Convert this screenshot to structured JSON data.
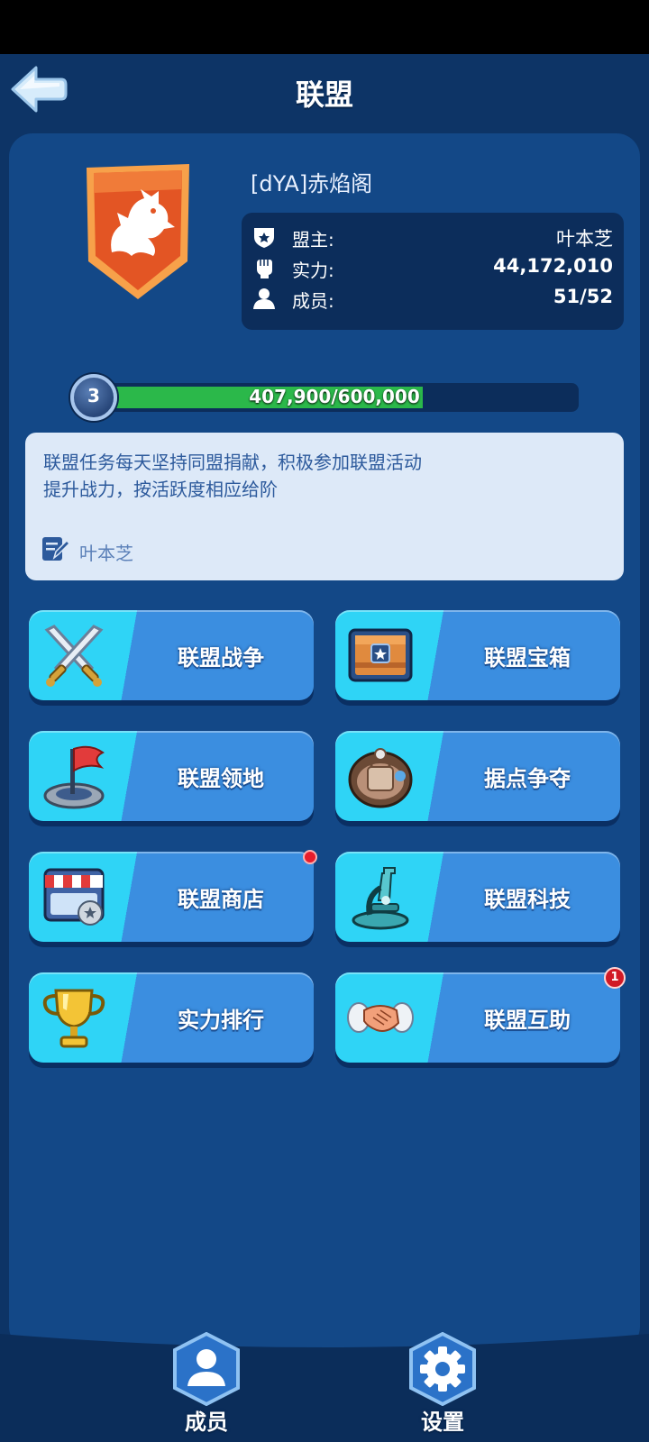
{
  "header": {
    "title": "联盟"
  },
  "alliance": {
    "name": "[dYA]赤焰阁",
    "leader_label": "盟主:",
    "leader": "叶本芝",
    "power_label": "实力:",
    "power": "44,172,010",
    "members_label": "成员:",
    "members": "51/52"
  },
  "progress": {
    "level": "3",
    "text": "407,900/600,000",
    "fraction": 0.68
  },
  "notice": {
    "text": "联盟任务每天坚持同盟捐献，积极参加联盟活动\n提升战力，按活跃度相应给阶",
    "author": "叶本芝"
  },
  "menu": {
    "war": "联盟战争",
    "chest": "联盟宝箱",
    "territory": "联盟领地",
    "stronghold": "据点争夺",
    "shop": "联盟商店",
    "tech": "联盟科技",
    "ranking": "实力排行",
    "help": "联盟互助",
    "help_badge": "1"
  },
  "dock": {
    "members": "成员",
    "settings": "设置"
  },
  "colors": {
    "panel": "#134887",
    "background": "#0d3466",
    "button_light": "#2fd4f6",
    "button_dark": "#3b8ee0",
    "progress": "#2bb84a"
  },
  "icons": [
    "back-arrow-icon",
    "wolf-emblem-icon",
    "shield-icon",
    "fist-icon",
    "person-icon",
    "edit-icon",
    "crossed-swords-icon",
    "chest-icon",
    "flag-icon",
    "fortress-icon",
    "shop-icon",
    "microscope-icon",
    "trophy-icon",
    "handshake-icon",
    "members-icon",
    "gear-icon"
  ]
}
